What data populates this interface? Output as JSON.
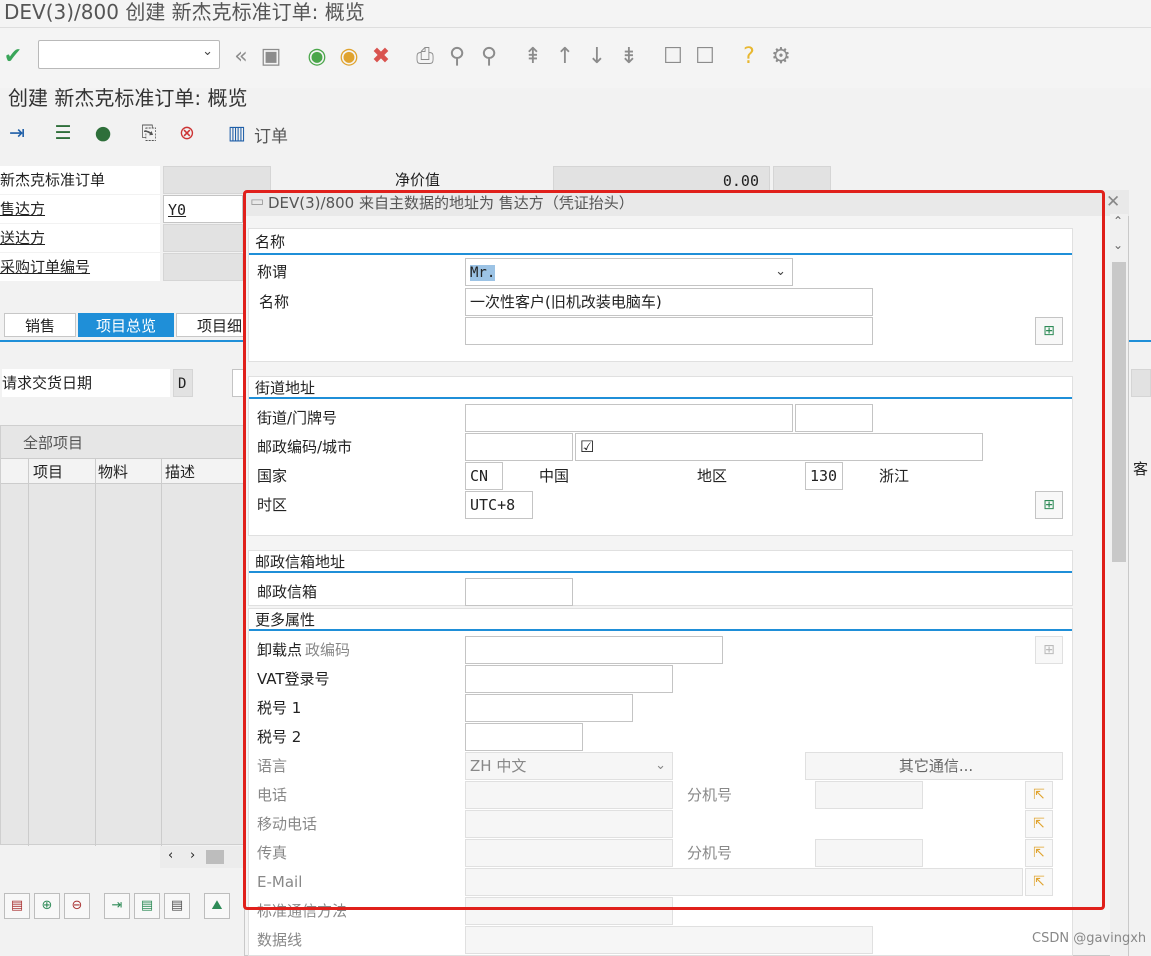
{
  "window": {
    "title": "DEV(3)/800 创建 新杰克标准订单: 概览"
  },
  "page_title": "创建 新杰克标准订单: 概览",
  "app_toolbar": {
    "order_label": "订单"
  },
  "header": {
    "order_type_label": "新杰克标准订单",
    "net_value_label": "净价值",
    "net_value": "0.00",
    "sold_to_label": "售达方",
    "sold_to_value": "Y0",
    "ship_to_label": "送达方",
    "po_label": "采购订单编号"
  },
  "tabs": [
    "销售",
    "项目总览",
    "项目细"
  ],
  "req_delivery": {
    "label": "请求交货日期",
    "value": "D"
  },
  "items_grid": {
    "title": "全部项目",
    "columns": [
      "项目",
      "物料",
      "描述"
    ],
    "right_col": "客"
  },
  "dialog": {
    "title": "DEV(3)/800 来自主数据的地址为 售达方（凭证抬头）",
    "name_section": {
      "title": "名称",
      "salutation_label": "称谓",
      "salutation_value": "Mr.",
      "name_label": "名称",
      "name_value": "一次性客户(旧机改装电脑车)"
    },
    "street_section": {
      "title": "街道地址",
      "street_label": "街道/门牌号",
      "postal_city_label": "邮政编码/城市",
      "country_label": "国家",
      "country_code": "CN",
      "country_name": "中国",
      "region_label": "地区",
      "region_code": "130",
      "region_name": "浙江",
      "timezone_label": "时区",
      "timezone_value": "UTC+8"
    },
    "pobox_section": {
      "title": "邮政信箱地址",
      "pobox_label": "邮政信箱"
    },
    "more_section": {
      "title": "更多属性",
      "unload_label": "卸载点",
      "unload_overlap_label": "政编码",
      "vat_label": "VAT登录号",
      "tax1_label": "税号 1",
      "tax2_label": "税号 2",
      "language_label": "语言",
      "language_value": "ZH 中文",
      "other_comm_label": "其它通信...",
      "phone_label": "电话",
      "ext_label": "分机号",
      "mobile_label": "移动电话",
      "fax_label": "传真",
      "fax_ext_label": "分机号",
      "email_label": "E-Mail",
      "std_comm_label": "标准通信方法",
      "dataline_label": "数据线"
    }
  },
  "watermark": "CSDN @gavingxh",
  "colors": {
    "accent": "#1f8fd8",
    "highlight": "#e0201b"
  }
}
